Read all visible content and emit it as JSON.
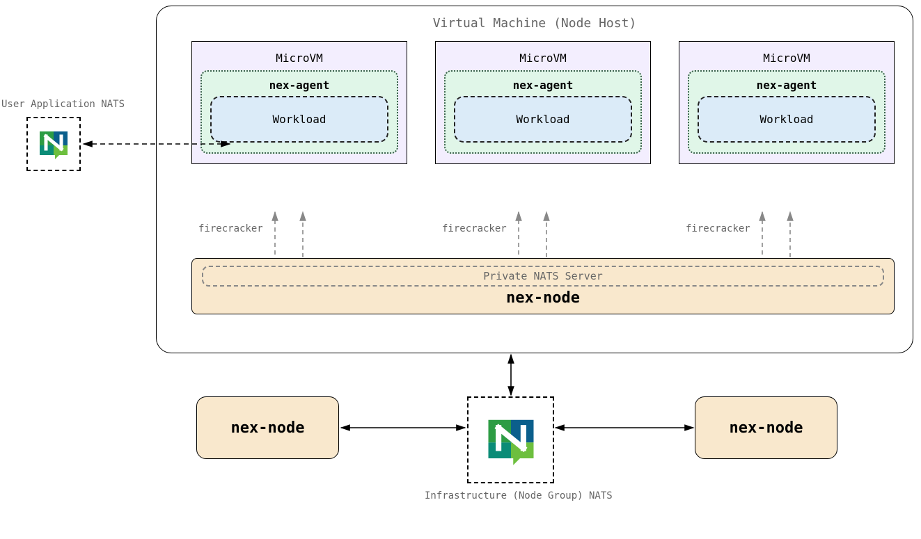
{
  "vm_host_title": "Virtual Machine (Node Host)",
  "microvms": [
    {
      "title": "MicroVM",
      "agent": "nex-agent",
      "workload": "Workload",
      "fc": "firecracker"
    },
    {
      "title": "MicroVM",
      "agent": "nex-agent",
      "workload": "Workload",
      "fc": "firecracker"
    },
    {
      "title": "MicroVM",
      "agent": "nex-agent",
      "workload": "Workload",
      "fc": "firecracker"
    }
  ],
  "private_nats": "Private NATS Server",
  "nex_node_main": "nex-node",
  "user_app_nats": "User Application NATS",
  "infra_nats": "Infrastructure (Node Group) NATS",
  "nex_node_left": "nex-node",
  "nex_node_right": "nex-node",
  "colors": {
    "lilac": "#f3eefe",
    "mint": "#e0f6e8",
    "blue": "#dbebf8",
    "sand": "#f9e8cd"
  }
}
